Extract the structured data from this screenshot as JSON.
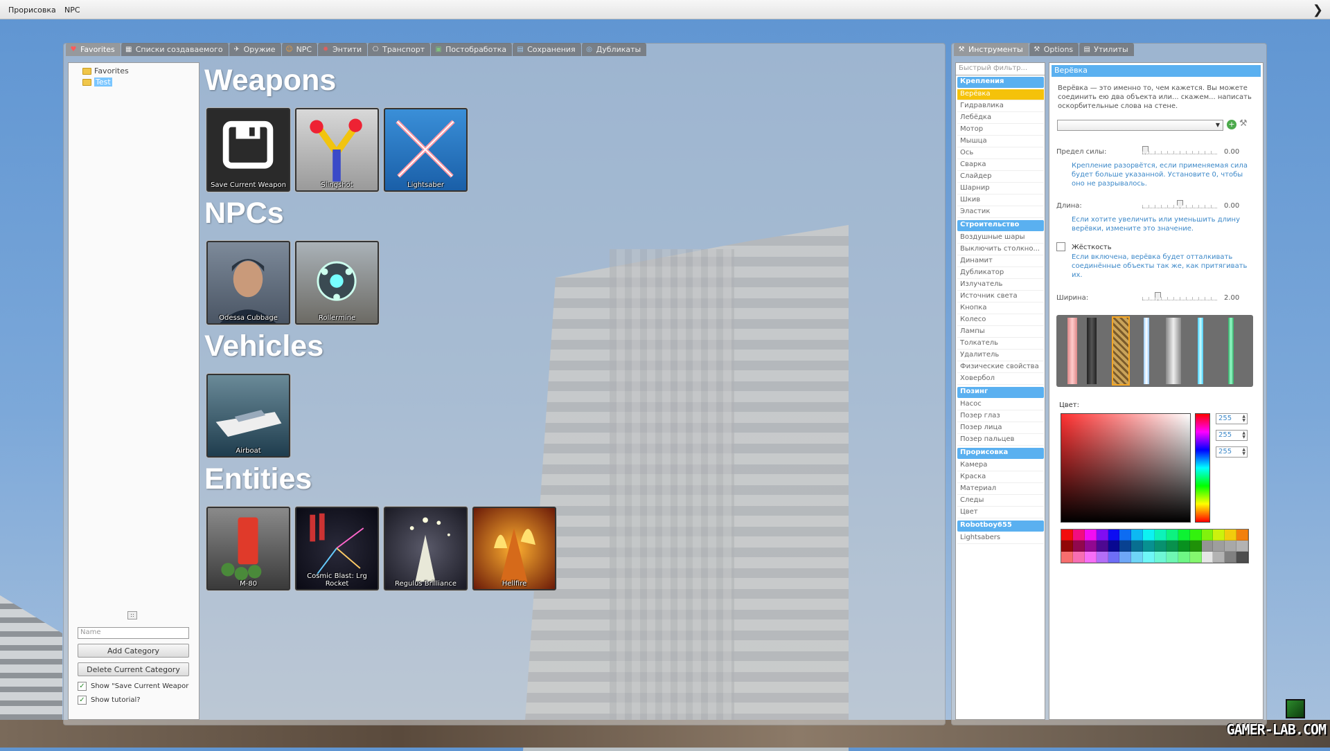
{
  "menubar": {
    "items": [
      "Прорисовка",
      "NPC"
    ]
  },
  "spawn_tabs": [
    {
      "label": "Favorites",
      "icon": "heart-icon"
    },
    {
      "label": "Списки создаваемого",
      "icon": "grid-icon"
    },
    {
      "label": "Оружие",
      "icon": "gun-icon"
    },
    {
      "label": "NPC",
      "icon": "npc-icon"
    },
    {
      "label": "Энтити",
      "icon": "entity-icon"
    },
    {
      "label": "Транспорт",
      "icon": "car-icon"
    },
    {
      "label": "Постобработка",
      "icon": "postprocess-icon"
    },
    {
      "label": "Сохранения",
      "icon": "save-icon"
    },
    {
      "label": "Дубликаты",
      "icon": "dupe-icon"
    }
  ],
  "tree": {
    "items": [
      "Favorites",
      "Test"
    ]
  },
  "tree_controls": {
    "name_placeholder": "Name",
    "add_category": "Add Category",
    "delete_category": "Delete Current Category",
    "show_save_weapon": "Show \"Save Current Weapor",
    "show_tutorial": "Show tutorial?"
  },
  "sections": {
    "weapons": "Weapons",
    "npcs": "NPCs",
    "vehicles": "Vehicles",
    "entities": "Entities"
  },
  "weapons": [
    "Save Current Weapon",
    "Slingshot",
    "Lightsaber"
  ],
  "npcs": [
    "Odessa Cubbage",
    "Rollermine"
  ],
  "vehicles": [
    "Airboat"
  ],
  "entities": [
    "M-80",
    "Cosmic Blast: Lrg Rocket",
    "Regulus Brilliance",
    "Hellfire"
  ],
  "tool_tabs": [
    {
      "label": "Инструменты",
      "icon": "wrench-icon"
    },
    {
      "label": "Options",
      "icon": "wrench-icon"
    },
    {
      "label": "Утилиты",
      "icon": "utilities-icon"
    }
  ],
  "tool_list": {
    "filter_placeholder": "Быстрый фильтр...",
    "categories": [
      {
        "name": "Крепления",
        "items": [
          "Верёвка",
          "Гидравлика",
          "Лебёдка",
          "Мотор",
          "Мышца",
          "Ось",
          "Сварка",
          "Слайдер",
          "Шарнир",
          "Шкив",
          "Эластик"
        ]
      },
      {
        "name": "Строительство",
        "items": [
          "Воздушные шары",
          "Выключить столкно...",
          "Динамит",
          "Дубликатор",
          "Излучатель",
          "Источник света",
          "Кнопка",
          "Колесо",
          "Лампы",
          "Толкатель",
          "Удалитель",
          "Физические свойства",
          "Ховербол"
        ]
      },
      {
        "name": "Позинг",
        "items": [
          "Насос",
          "Позер глаз",
          "Позер лица",
          "Позер пальцев"
        ]
      },
      {
        "name": "Прорисовка",
        "items": [
          "Камера",
          "Краска",
          "Материал",
          "Следы",
          "Цвет"
        ]
      },
      {
        "name": "Robotboy655",
        "items": [
          "Lightsabers"
        ]
      }
    ],
    "selected": "Верёвка"
  },
  "props": {
    "title": "Верёвка",
    "description": "Верёвка — это именно то, чем кажется. Вы можете соединить ею два объекта или... скажем... написать оскорбительные слова на стене.",
    "force_label": "Предел силы:",
    "force_value": "0.00",
    "force_help": "Крепление разорвётся, если применяемая сила будет больше указанной. Установите 0, чтобы оно не разрывалось.",
    "length_label": "Длина:",
    "length_value": "0.00",
    "length_help": "Если хотите увеличить или уменьшить длину верёвки, измените это значение.",
    "rigid_label": "Жёсткость",
    "rigid_help": "Если включена, верёвка будет отталкивать соединённые объекты так же, как притягивать их.",
    "width_label": "Ширина:",
    "width_value": "2.00",
    "color_label": "Цвет:",
    "rgb": [
      "255",
      "255",
      "255"
    ]
  },
  "watermark": "GAMER-LAB.COM"
}
